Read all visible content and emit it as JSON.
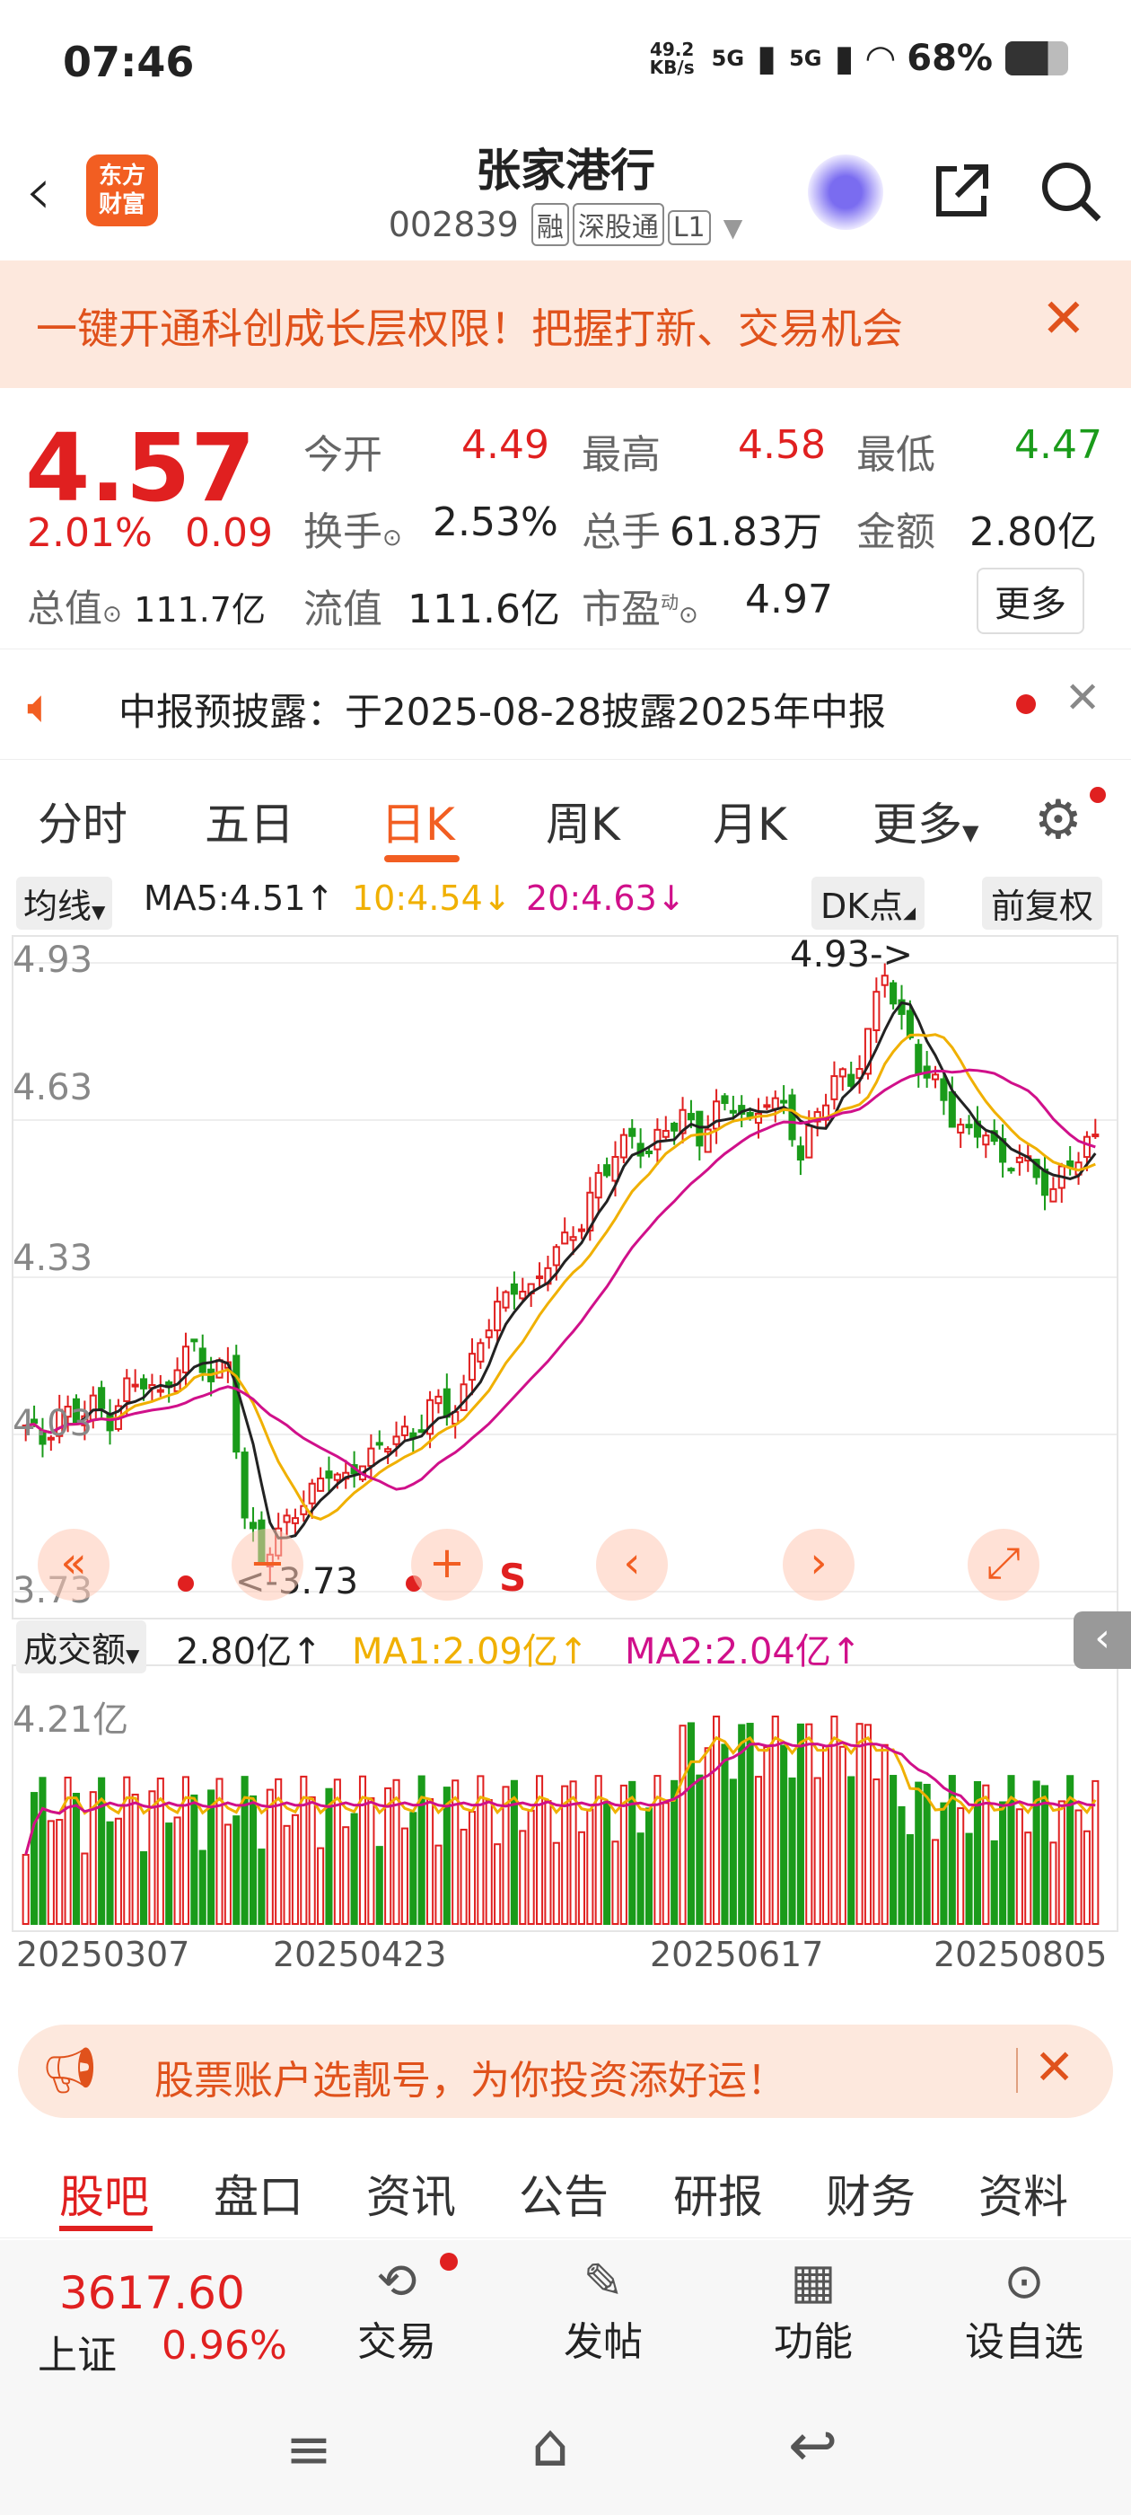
{
  "status_bar": {
    "time": "07:46",
    "net_speed": "49.2 KB/s",
    "signal1": "5G",
    "signal2": "5G",
    "battery": "68%"
  },
  "header": {
    "title": "张家港行",
    "code": "002839",
    "tags": [
      "融",
      "深股通",
      "L1"
    ],
    "logo_line1": "东方",
    "logo_line2": "财富"
  },
  "promo_top": {
    "text": "一键开通科创成长层权限！把握打新、交易机会"
  },
  "quote": {
    "price": "4.57",
    "change_pct": "2.01%",
    "change": "0.09",
    "open_label": "今开",
    "open": "4.49",
    "high_label": "最高",
    "high": "4.58",
    "low_label": "最低",
    "low": "4.47",
    "turnover_label": "换手",
    "turnover": "2.53%",
    "volume_label": "总手",
    "volume": "61.83万",
    "amount_label": "金额",
    "amount": "2.80亿",
    "mktcap_label": "总值",
    "mktcap": "111.7亿",
    "float_label": "流值",
    "float": "111.6亿",
    "pe_label": "市盈",
    "pe_sup": "动",
    "pe": "4.97",
    "more": "更多"
  },
  "notice": {
    "text": "中报预披露：于2025-08-28披露2025年中报"
  },
  "tabs": [
    "分时",
    "五日",
    "日K",
    "周K",
    "月K",
    "更多"
  ],
  "chart_controls": {
    "ma_label": "均线",
    "ma5": "MA5:4.51↑",
    "ma10": "10:4.54↓",
    "ma20": "20:4.63↓",
    "dk": "DK点",
    "fq": "前复权"
  },
  "chart_data": {
    "type": "candlestick",
    "y_ticks": [
      "4.93",
      "4.63",
      "4.33",
      "4.03",
      "3.73"
    ],
    "ylim": [
      3.73,
      4.93
    ],
    "x_ticks": [
      "20250307",
      "20250423",
      "20250617",
      "20250805"
    ],
    "annotations": {
      "high": "4.93->",
      "low": "<-3.73",
      "s_marker": "S"
    },
    "close_path": [
      4.03,
      4.0,
      4.05,
      4.05,
      4.07,
      4.04,
      4.1,
      4.12,
      4.08,
      4.15,
      4.18,
      4.12,
      4.15,
      3.85,
      3.78,
      3.82,
      3.87,
      3.9,
      3.95,
      3.92,
      3.97,
      3.98,
      4.02,
      4.0,
      4.08,
      4.05,
      4.1,
      4.2,
      4.25,
      4.3,
      4.28,
      4.35,
      4.38,
      4.42,
      4.5,
      4.55,
      4.58,
      4.55,
      4.6,
      4.62,
      4.58,
      4.63,
      4.65,
      4.6,
      4.66,
      4.63,
      4.55,
      4.62,
      4.7,
      4.68,
      4.78,
      4.9,
      4.8,
      4.72,
      4.68,
      4.62,
      4.58,
      4.6,
      4.52,
      4.55,
      4.5,
      4.48,
      4.53,
      4.57
    ],
    "volume": {
      "label": "成交额",
      "value": "2.80亿↑",
      "ma1": "MA1:2.09亿↑",
      "ma2": "MA2:2.04亿↑",
      "max_tick": "4.21亿"
    }
  },
  "chart_buttons": [
    "«",
    "−",
    "+",
    "‹",
    "›",
    "⤢"
  ],
  "promo_bottom": {
    "text": "股票账户选靓号，为你投资添好运！"
  },
  "sub_tabs": [
    "股吧",
    "盘口",
    "资讯",
    "公告",
    "研报",
    "财务",
    "资料"
  ],
  "bottom_bar": {
    "index_value": "3617.60",
    "index_name": "上证",
    "index_change": "0.96%",
    "items": [
      "交易",
      "发帖",
      "功能",
      "设自选"
    ]
  },
  "colors": {
    "up": "#e02020",
    "down": "#1a9b1a",
    "accent": "#f25e22",
    "ma5": "#222222",
    "ma10": "#f0b000",
    "ma20": "#d0108a"
  }
}
